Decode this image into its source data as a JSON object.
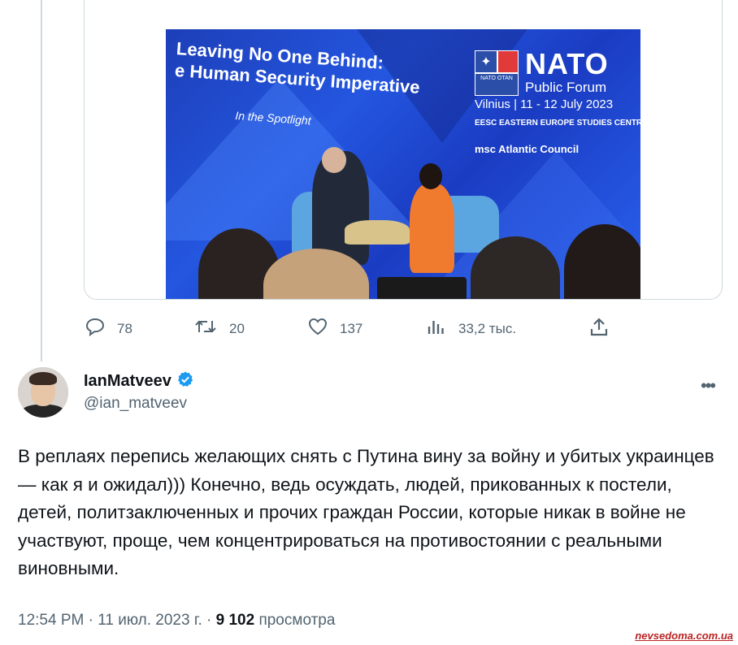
{
  "embed": {
    "slide_title": "Leaving No One Behind:\ne Human Security Imperative",
    "slide_subtitle": "In the Spotlight",
    "nato_word": "NATO",
    "nato_forum": "Public Forum",
    "nato_emblem_text": "NATO OTAN",
    "event_dates": "Vilnius | 11 - 12 July 2023",
    "sponsors_line1": "EESC  EASTERN EUROPE STUDIES CENTRE   G|M|F",
    "sponsors_line2": "msc   Atlantic Council"
  },
  "actions": {
    "replies": "78",
    "retweets": "20",
    "likes": "137",
    "views": "33,2 тыс."
  },
  "tweet": {
    "display_name": "IanMatveev",
    "handle": "@ian_matveev",
    "more_label": "•••",
    "text": "В реплаях перепись желающих снять с Путина вину за войну и убитых украинцев — как я и ожидал))) Конечно, ведь осуждать, людей, прикованных к постели, детей, политзаключенных и прочих граждан России, которые никак в войне не участвуют, проще, чем концентрироваться на противостоянии с реальными виновными.",
    "timestamp": "12:54 PM · 11 июл. 2023 г. · ",
    "views_count": "9 102",
    "views_label": "просмотра"
  },
  "watermark": "nevsedoma.com.ua",
  "colors": {
    "secondary_text": "#536471",
    "primary_text": "#0f1419",
    "verified_blue": "#1d9bf0",
    "slide_blue": "#2456e0"
  }
}
